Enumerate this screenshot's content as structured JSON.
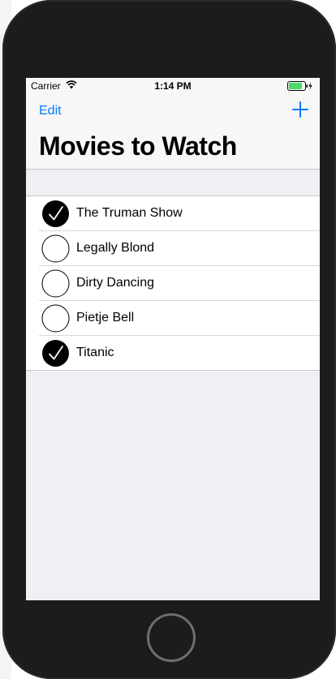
{
  "status_bar": {
    "carrier": "Carrier",
    "time": "1:14 PM",
    "battery_color": "#4cd964"
  },
  "navbar": {
    "edit_label": "Edit",
    "add_icon": "plus-icon",
    "title": "Movies to Watch",
    "accent_color": "#007aff"
  },
  "movies": [
    {
      "title": "The Truman Show",
      "watched": true
    },
    {
      "title": "Legally Blond",
      "watched": false
    },
    {
      "title": "Dirty Dancing",
      "watched": false
    },
    {
      "title": "Pietje Bell",
      "watched": false
    },
    {
      "title": "Titanic",
      "watched": true
    }
  ]
}
